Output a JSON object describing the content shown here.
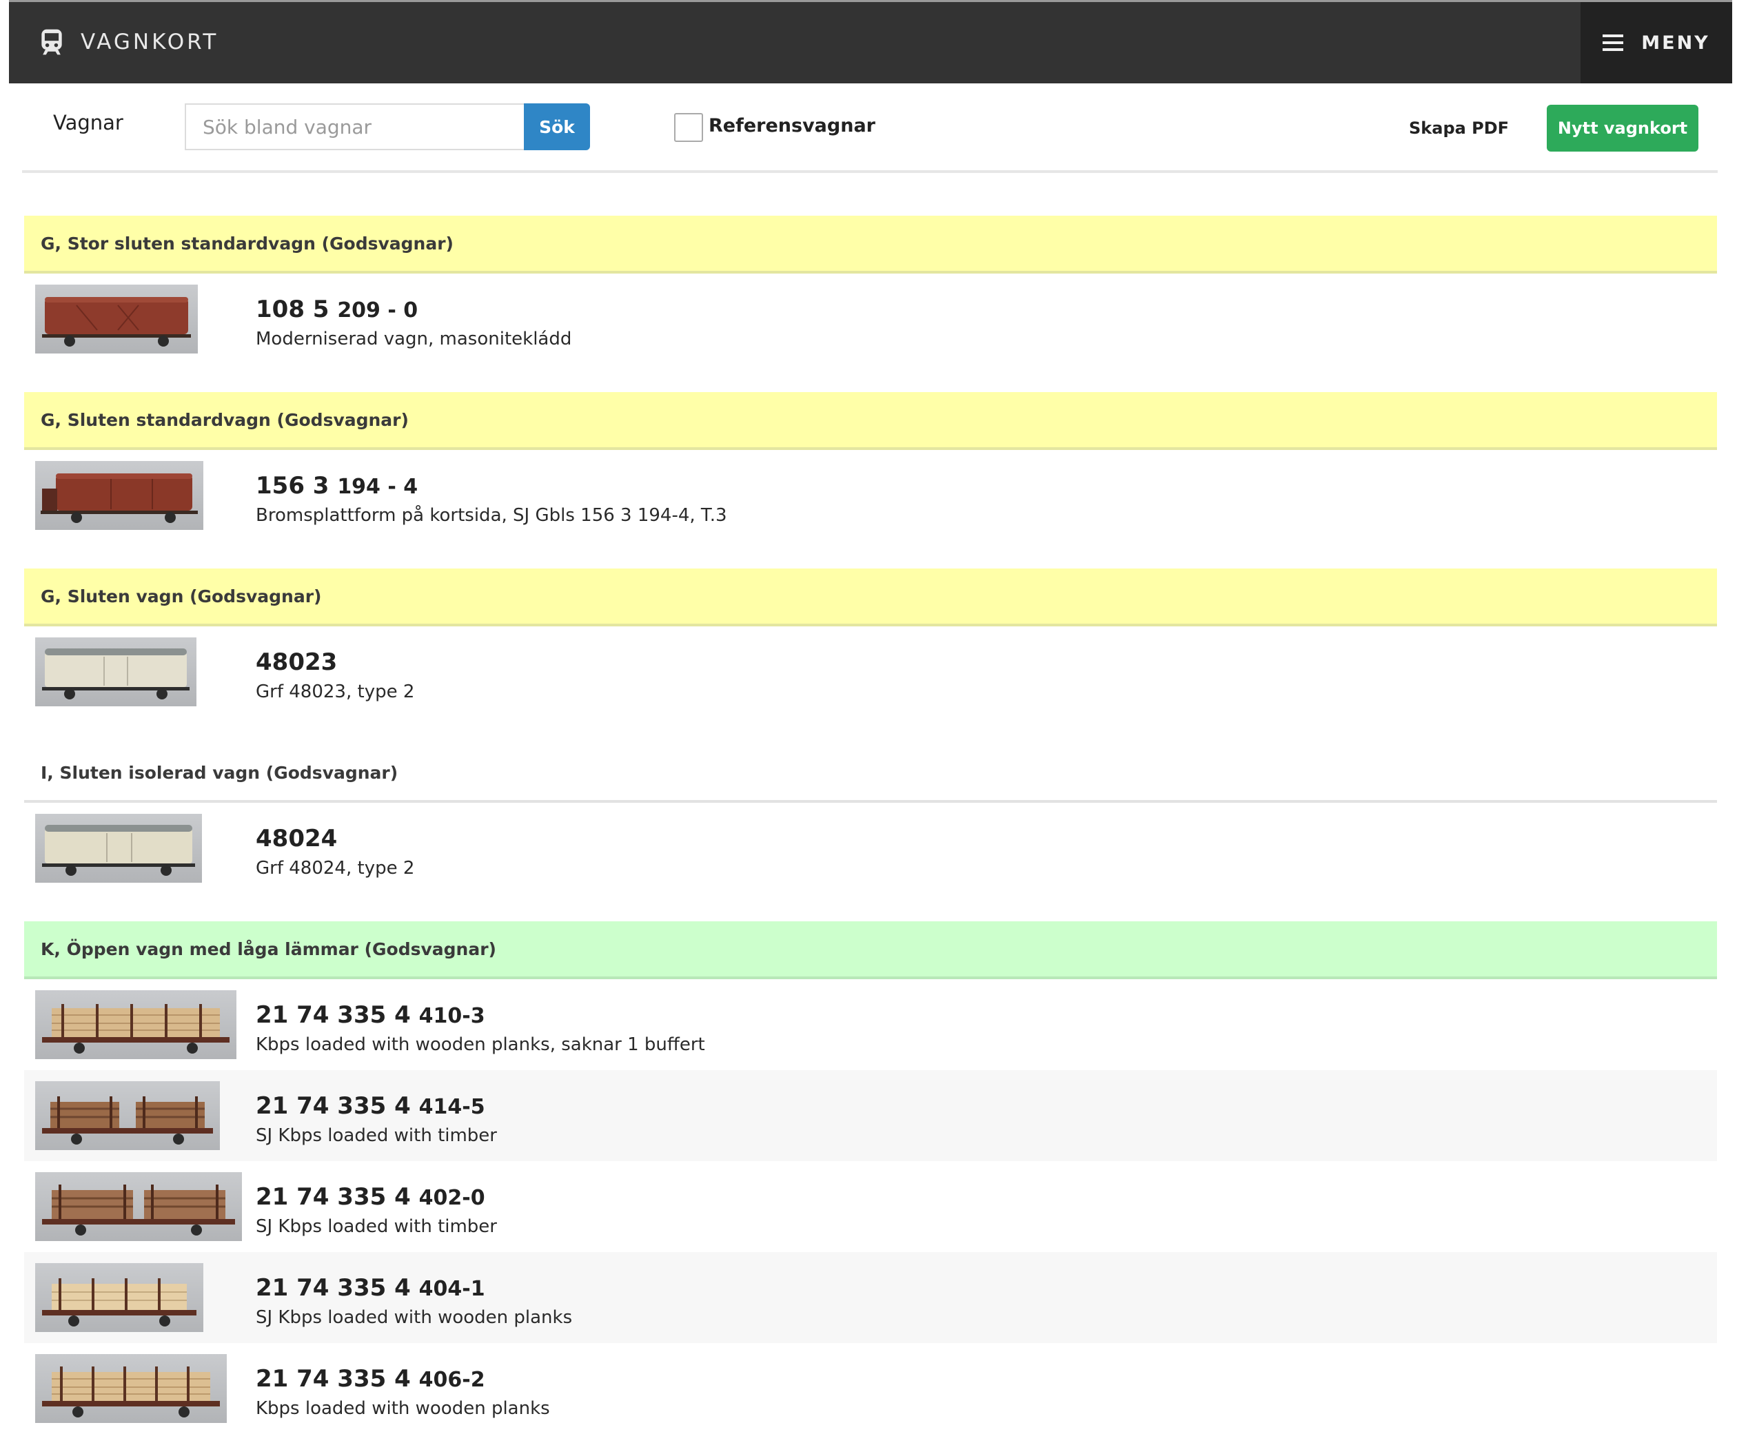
{
  "app": {
    "brand": "VAGNKORT",
    "menu_label": "MENY"
  },
  "toolbar": {
    "label": "Vagnar",
    "search_placeholder": "Sök bland vagnar",
    "search_button": "Sök",
    "reference_label": "Referensvagnar",
    "reference_checked": false,
    "pdf_label": "Skapa PDF",
    "new_button": "Nytt vagnkort"
  },
  "colors": {
    "topbar": "#333333",
    "search_button": "#2f86c6",
    "new_button": "#2daa5a",
    "section_yellow": "#ffffa8",
    "section_green": "#ccffcc"
  },
  "sections": [
    {
      "title": "G, Stor sluten standardvagn (Godsvagnar)",
      "color": "yellow",
      "wagons": [
        {
          "number": "108 5",
          "number_suffix": "209 - 0",
          "description": "Moderniserad vagn, masonitekládd",
          "thumb": "red-boxcar"
        }
      ]
    },
    {
      "title": "G, Sluten standardvagn (Godsvagnar)",
      "color": "yellow",
      "wagons": [
        {
          "number": "156 3",
          "number_suffix": "194 - 4",
          "description": "Bromsplattform på kortsida, SJ Gbls 156 3 194-4, T.3",
          "thumb": "red-boxcar-platform"
        }
      ]
    },
    {
      "title": "G, Sluten vagn (Godsvagnar)",
      "color": "yellow",
      "wagons": [
        {
          "number": "48023",
          "number_suffix": "",
          "description": "Grf 48023, type 2",
          "thumb": "white-boxcar"
        }
      ]
    },
    {
      "title": "I, Sluten isolerad vagn (Godsvagnar)",
      "color": "plain",
      "wagons": [
        {
          "number": "48024",
          "number_suffix": "",
          "description": "Grf 48024, type 2",
          "thumb": "white-boxcar"
        }
      ]
    },
    {
      "title": "K, Öppen vagn med låga lämmar (Godsvagnar)",
      "color": "green",
      "wagons": [
        {
          "number": "21 74 335 4",
          "number_suffix": "410-3",
          "description": "Kbps loaded with wooden planks, saknar 1 buffert",
          "thumb": "flatcar-planks"
        },
        {
          "number": "21 74 335 4",
          "number_suffix": "414-5",
          "description": "SJ Kbps loaded with timber",
          "thumb": "flatcar-timber"
        },
        {
          "number": "21 74 335 4",
          "number_suffix": "402-0",
          "description": "SJ Kbps loaded with timber",
          "thumb": "flatcar-timber"
        },
        {
          "number": "21 74 335 4",
          "number_suffix": "404-1",
          "description": "SJ Kbps loaded with wooden planks",
          "thumb": "flatcar-planks"
        },
        {
          "number": "21 74 335 4",
          "number_suffix": "406-2",
          "description": "Kbps loaded with wooden planks",
          "thumb": "flatcar-planks"
        }
      ]
    }
  ]
}
